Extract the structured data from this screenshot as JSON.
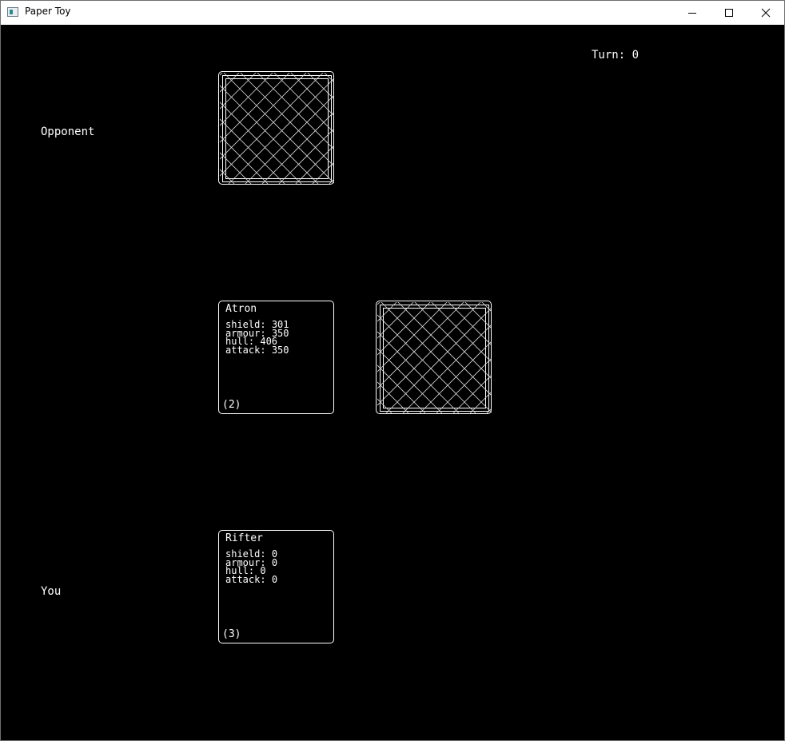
{
  "window": {
    "title": "Paper Toy"
  },
  "hud": {
    "turn_label": "Turn:",
    "turn_value": "0"
  },
  "players": {
    "opponent": "Opponent",
    "you": "You"
  },
  "cards": {
    "middle": {
      "name": "Atron",
      "stats": [
        {
          "label": "shield:",
          "value": "301"
        },
        {
          "label": "armour:",
          "value": "350"
        },
        {
          "label": "hull:",
          "value": "406"
        },
        {
          "label": "attack:",
          "value": "350"
        }
      ],
      "count": "(2)"
    },
    "bottom": {
      "name": "Rifter",
      "stats": [
        {
          "label": "shield:",
          "value": "0"
        },
        {
          "label": "armour:",
          "value": "0"
        },
        {
          "label": "hull:",
          "value": "0"
        },
        {
          "label": "attack:",
          "value": "0"
        }
      ],
      "count": "(3)"
    }
  },
  "icons": {
    "app": "app-icon",
    "minimize": "minimize-icon",
    "maximize": "maximize-icon",
    "close": "close-icon"
  },
  "colors": {
    "background": "#000000",
    "foreground": "#ffffff"
  }
}
